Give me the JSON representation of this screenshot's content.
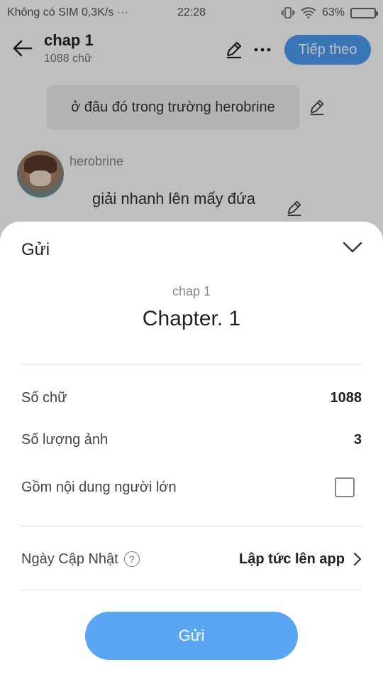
{
  "status_bar": {
    "carrier": "Không có SIM 0,3K/s ···",
    "time": "22:28",
    "battery": "63%",
    "battery_level": 0.63
  },
  "topbar": {
    "title": "chap 1",
    "word_count": "1088 chữ",
    "next_label": "Tiếp theo"
  },
  "chat": {
    "top_bubble": "ở đâu đó trong trường herobrine",
    "author": "herobrine",
    "message": "giải nhanh lên mấy đứa"
  },
  "sheet": {
    "title": "Gửi",
    "subtitle": "chap 1",
    "chapter_name": "Chapter. 1",
    "rows": {
      "word_count_label": "Số chữ",
      "word_count_value": "1088",
      "image_count_label": "Số lượng ảnh",
      "image_count_value": "3",
      "adult_label": "Gồm nội dung người lớn",
      "update_label": "Ngày Cập Nhật",
      "update_value": "Lập tức lên app"
    },
    "submit_label": "Gửi"
  },
  "colors": {
    "accent": "#4b9cf0",
    "submit": "#5aa6f2"
  }
}
